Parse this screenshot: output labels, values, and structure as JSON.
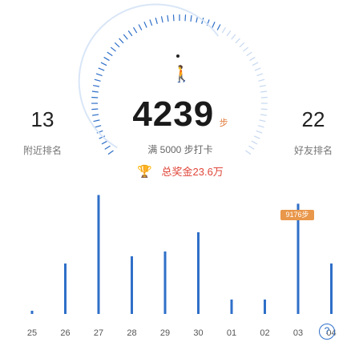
{
  "left_rank": {
    "value": "13",
    "label": "附近排名"
  },
  "right_rank": {
    "value": "22",
    "label": "好友排名"
  },
  "steps": {
    "value": "4239",
    "unit": "步"
  },
  "target_text": "满 5000 步打卡",
  "prize_text": "总奖金23.6万",
  "icons": {
    "walker": "walking-person-icon",
    "trophy": "trophy-icon",
    "help": "help-icon"
  },
  "chart_data": {
    "type": "bar",
    "categories": [
      "25",
      "26",
      "27",
      "28",
      "29",
      "30",
      "01",
      "02",
      "03",
      "04"
    ],
    "values": [
      100,
      4200,
      9900,
      4800,
      5200,
      6800,
      1200,
      1200,
      9176,
      4200
    ],
    "highlight_label": "9176步",
    "highlight_index": 8
  },
  "colors": {
    "bar": "#2f6fc8",
    "accent": "#e4412e",
    "gauge": "#2f6fc8"
  }
}
